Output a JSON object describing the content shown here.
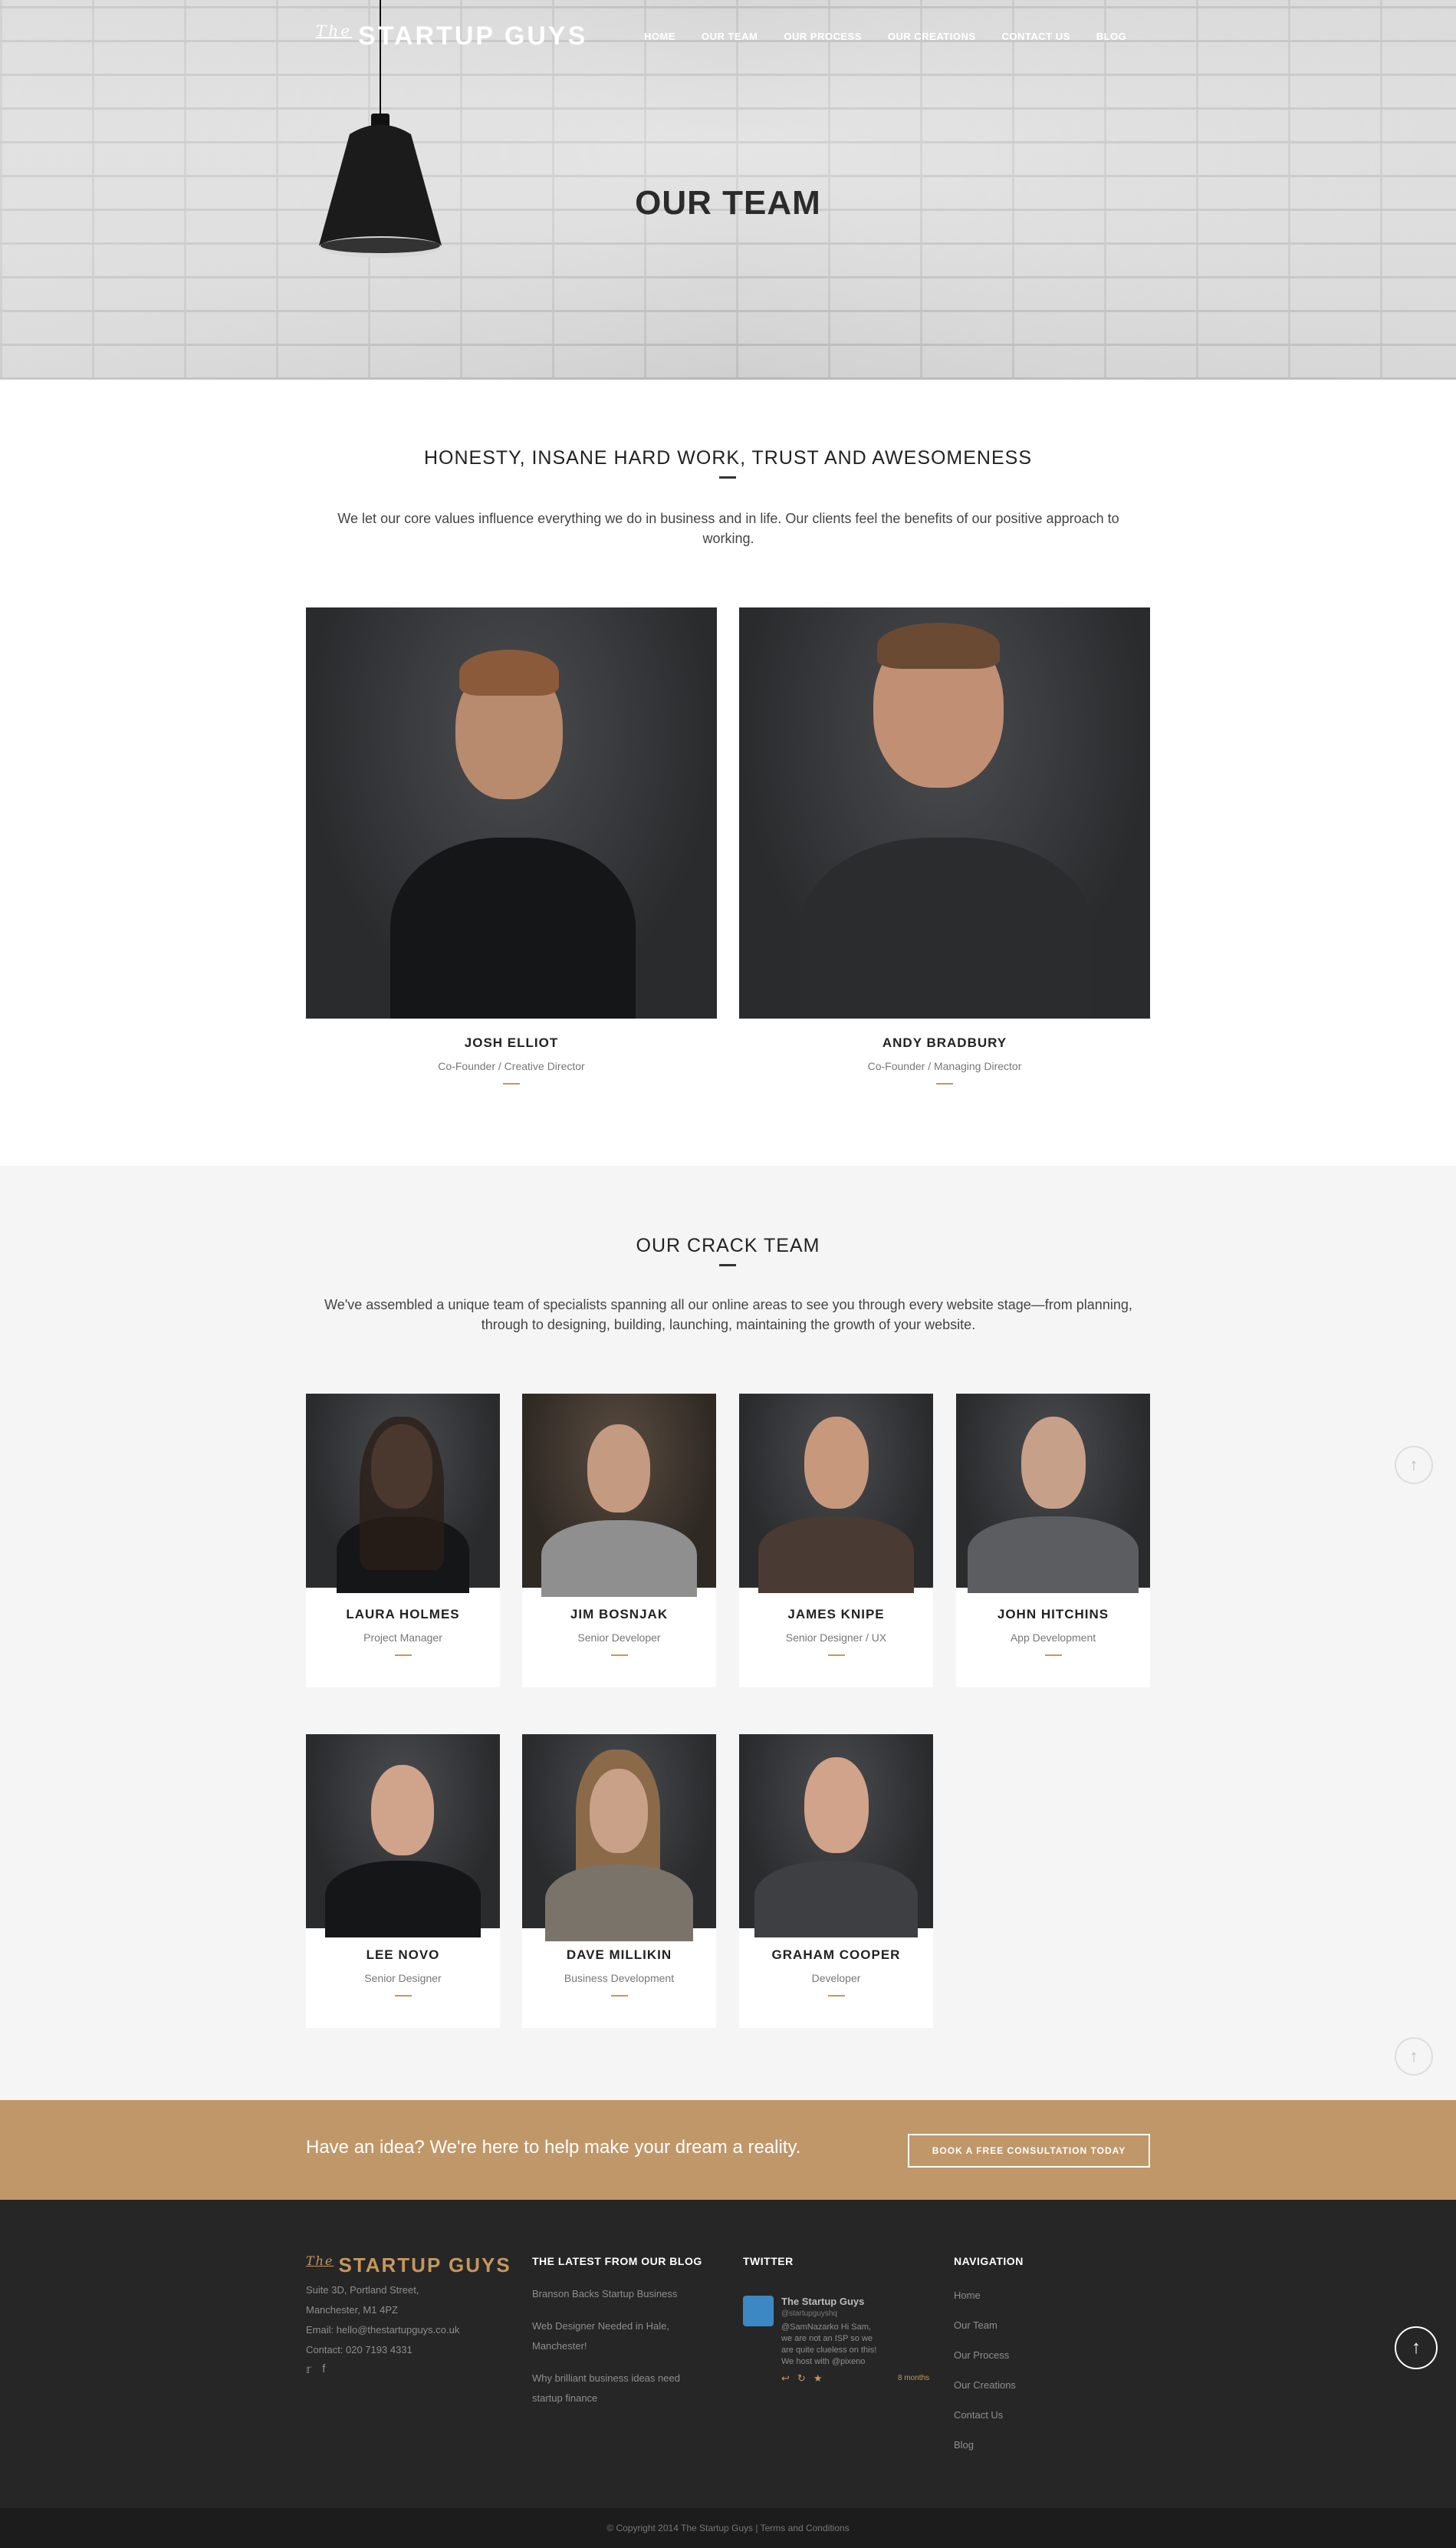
{
  "header": {
    "logo_prefix": "The",
    "logo_text": "STARTUP GUYS",
    "nav": [
      "HOME",
      "OUR TEAM",
      "OUR PROCESS",
      "OUR CREATIONS",
      "CONTACT US",
      "BLOG"
    ]
  },
  "hero": {
    "title": "OUR TEAM"
  },
  "values": {
    "heading": "HONESTY, INSANE HARD WORK, TRUST AND AWESOMENESS",
    "intro": "We let our core values influence everything we do in business and in life. Our clients feel the benefits of our positive approach to working."
  },
  "founders": [
    {
      "name": "JOSH ELLIOT",
      "role": "Co-Founder / Creative Director"
    },
    {
      "name": "ANDY BRADBURY",
      "role": "Co-Founder / Managing Director"
    }
  ],
  "crack_team": {
    "heading": "OUR CRACK TEAM",
    "intro": "We've assembled a unique team of specialists spanning all our online areas to see you through every website stage—from planning, through to designing, building, launching, maintaining the growth of your website.",
    "members": [
      {
        "name": "LAURA HOLMES",
        "role": "Project Manager"
      },
      {
        "name": "JIM BOSNJAK",
        "role": "Senior Developer"
      },
      {
        "name": "JAMES KNIPE",
        "role": "Senior Designer / UX"
      },
      {
        "name": "JOHN HITCHINS",
        "role": "App Development"
      },
      {
        "name": "LEE NOVO",
        "role": "Senior Designer"
      },
      {
        "name": "DAVE MILLIKIN",
        "role": "Business Development"
      },
      {
        "name": "GRAHAM COOPER",
        "role": "Developer"
      }
    ]
  },
  "cta": {
    "text": "Have an idea? We're here to help make your dream a reality.",
    "button": "BOOK A FREE CONSULTATION TODAY"
  },
  "footer": {
    "logo_prefix": "The",
    "logo_text": "STARTUP GUYS",
    "address": [
      "Suite 3D, Portland Street,",
      "Manchester, M1 4PZ",
      "Email: hello@thestartupguys.co.uk",
      "Contact: 020 7193 4331"
    ],
    "blog_heading": "THE LATEST FROM OUR BLOG",
    "blog_posts": [
      "Branson Backs Startup Business",
      "Web Designer Needed in Hale, Manchester!",
      "Why brilliant business ideas need startup finance"
    ],
    "twitter_heading": "TWITTER",
    "tweet": {
      "name": "The Startup Guys",
      "handle": "@startupguyshq",
      "text": "@SamNazarko Hi Sam, we are not an ISP so we are quite clueless on this! We host with @pixeno",
      "time": "8 months"
    },
    "nav_heading": "NAVIGATION",
    "nav_items": [
      "Home",
      "Our Team",
      "Our Process",
      "Our Creations",
      "Contact Us",
      "Blog"
    ],
    "copyright": "© Copyright 2014 The Startup Guys | Terms and Conditions"
  },
  "colors": {
    "accent": "#c09769",
    "footer_bg": "#262626",
    "crack_bg": "#f5f5f5"
  },
  "icons": {
    "scroll_top": "arrow-up-icon",
    "twitter": "twitter-icon",
    "facebook": "facebook-icon"
  }
}
